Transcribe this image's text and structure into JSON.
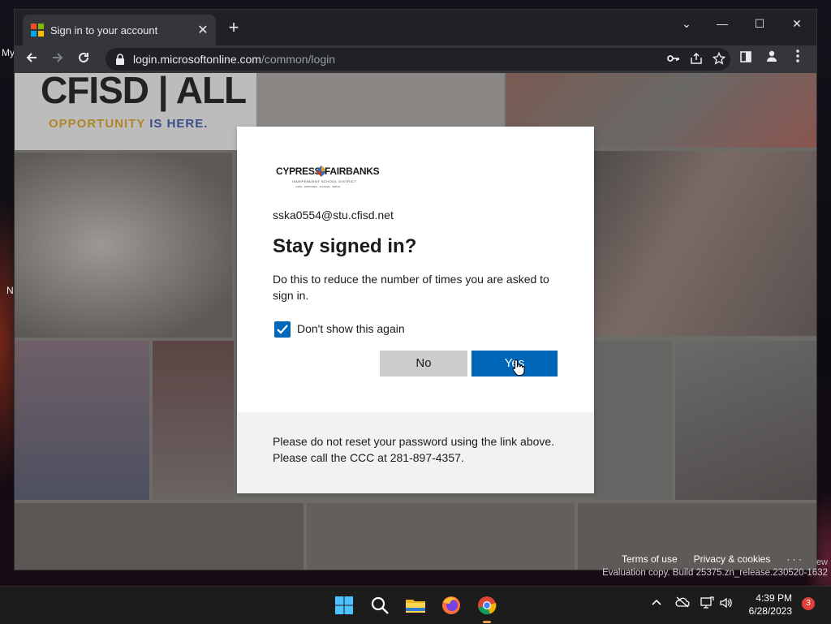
{
  "desktop": {
    "fragments": [
      "My",
      "N"
    ]
  },
  "browser": {
    "tab_title": "Sign in to your account",
    "tab_close": "✕",
    "new_tab": "+",
    "url_host": "login.microsoftonline.com",
    "url_path": "/common/login",
    "window_controls": {
      "dropdown": "⌄",
      "minimize": "—",
      "maximize": "☐",
      "close": "✕"
    }
  },
  "page": {
    "banner_logo": "CFISD | ALL",
    "banner_tagline_a": "OPPORTUNITY",
    "banner_tagline_b": "IS HERE.",
    "footer": {
      "terms": "Terms of use",
      "privacy": "Privacy & cookies",
      "more": "· · ·"
    }
  },
  "dialog": {
    "org_logo": {
      "left": "CYPRESS",
      "right": "FAIRBANKS",
      "subtitle": "INDEPENDENT SCHOOL DISTRICT",
      "motto": "CARE · EMPOWER · ACHIEVE · SERVE"
    },
    "identity": "sska0554@stu.cfisd.net",
    "heading": "Stay signed in?",
    "description": "Do this to reduce the number of times you are asked to sign in.",
    "checkbox_label": "Don't show this again",
    "checkbox_checked": true,
    "no_label": "No",
    "yes_label": "Yes",
    "notice": "Please do not reset your password using the link above. Please call the CCC at 281-897-4357."
  },
  "os": {
    "watermark": "Evaluation copy. Build 25375.zn_release.230520-1632",
    "watermark_edge": "ew",
    "clock_time": "4:39 PM",
    "clock_date": "6/28/2023",
    "notification_count": "3"
  },
  "colors": {
    "accent": "#0067b8",
    "ms_red": "#f25022",
    "ms_green": "#7fba00",
    "ms_blue": "#00a4ef",
    "ms_yellow": "#ffb900"
  }
}
